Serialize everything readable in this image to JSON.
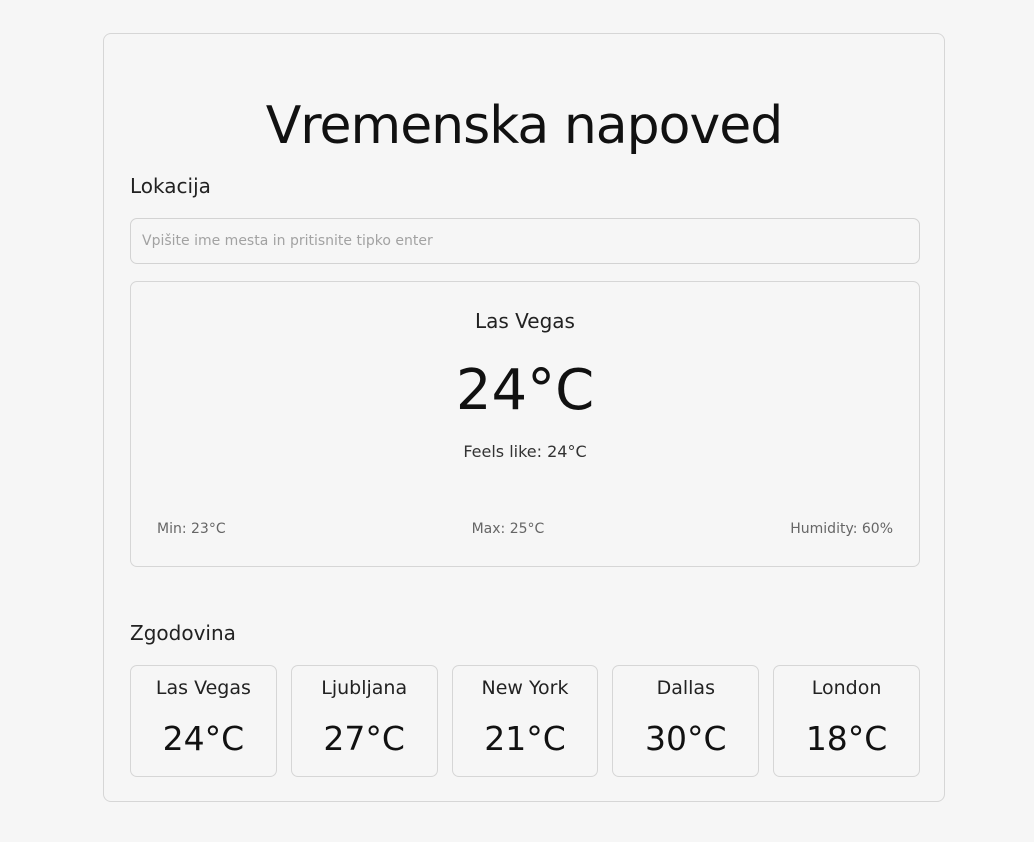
{
  "header": {
    "title": "Vremenska napoved"
  },
  "location": {
    "label": "Lokacija",
    "placeholder": "Vpišite ime mesta in pritisnite tipko enter",
    "value": ""
  },
  "current": {
    "city": "Las Vegas",
    "temperature": "24°C",
    "feels_like": "Feels like: 24°C",
    "min": "Min: 23°C",
    "max": "Max: 25°C",
    "humidity": "Humidity: 60%"
  },
  "history": {
    "label": "Zgodovina",
    "items": [
      {
        "city": "Las Vegas",
        "temperature": "24°C"
      },
      {
        "city": "Ljubljana",
        "temperature": "27°C"
      },
      {
        "city": "New York",
        "temperature": "21°C"
      },
      {
        "city": "Dallas",
        "temperature": "30°C"
      },
      {
        "city": "London",
        "temperature": "18°C"
      }
    ]
  }
}
